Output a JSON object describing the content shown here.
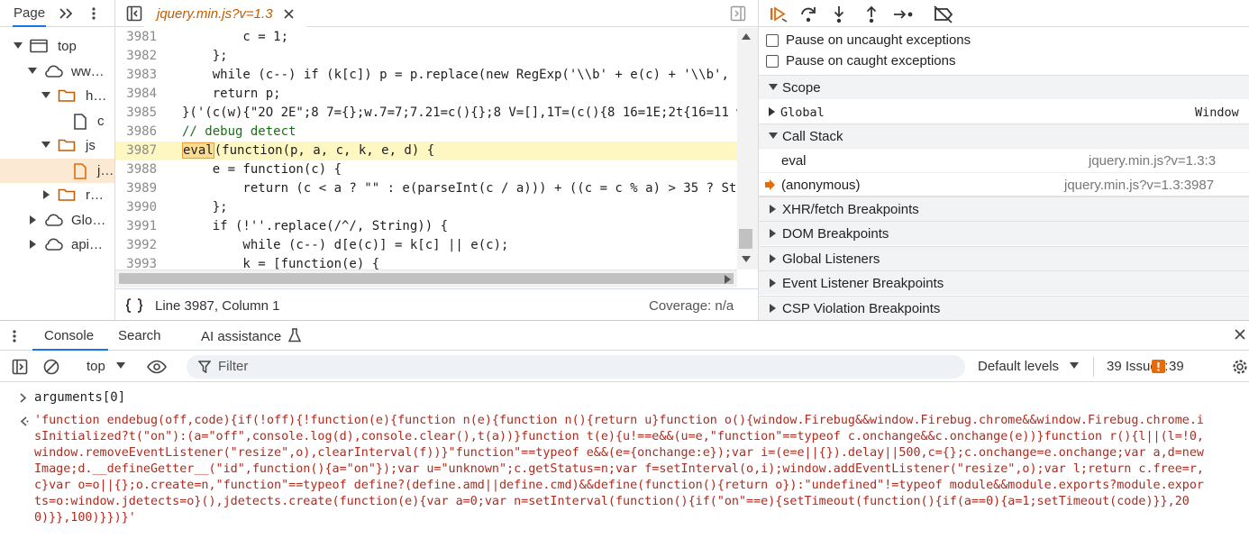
{
  "navigator": {
    "tab_label": "Page",
    "tree": [
      {
        "label": "top",
        "level": 0
      },
      {
        "label": "ww…",
        "level": 1
      },
      {
        "label": "h…",
        "level": 2
      },
      {
        "label": "c",
        "level": 3
      },
      {
        "label": "js",
        "level": 2
      },
      {
        "label": "j…",
        "level": 3
      },
      {
        "label": "r…",
        "level": 2
      },
      {
        "label": "Glo…",
        "level": 1
      },
      {
        "label": "api…",
        "level": 1
      }
    ]
  },
  "editor": {
    "tab_label": "jquery.min.js?v=1.3",
    "lines": [
      {
        "n": "3981",
        "t": "        c = 1;"
      },
      {
        "n": "3982",
        "t": "    };"
      },
      {
        "n": "3983",
        "t": "    while (c--) if (k[c]) p = p.replace(new RegExp('\\\\b' + e(c) + '\\\\b', 'g"
      },
      {
        "n": "3984",
        "t": "    return p;"
      },
      {
        "n": "3985",
        "t": "}('(c(w){\"2O 2E\";8 7={};w.7=7;7.21=c(){};8 V=[],1T=(c(){8 16=1E;2t{16=11 w."
      },
      {
        "n": "3986",
        "t": "// debug detect"
      },
      {
        "n": "3987",
        "t": "(function(p, a, c, k, e, d) {",
        "mark": "eval"
      },
      {
        "n": "3988",
        "t": "    e = function(c) {"
      },
      {
        "n": "3989",
        "t": "        return (c < a ? \"\" : e(parseInt(c / a))) + ((c = c % a) > 35 ? Stri"
      },
      {
        "n": "3990",
        "t": "    };"
      },
      {
        "n": "3991",
        "t": "    if (!''.replace(/^/, String)) {"
      },
      {
        "n": "3992",
        "t": "        while (c--) d[e(c)] = k[c] || e(c);"
      },
      {
        "n": "3993",
        "t": "        k = [function(e) {"
      }
    ],
    "status": {
      "cursor": "Line 3987, Column 1",
      "coverage": "Coverage: n/a"
    }
  },
  "debugger": {
    "pause_uncaught": "Pause on uncaught exceptions",
    "pause_caught": "Pause on caught exceptions",
    "scope_label": "Scope",
    "global_label": "Global",
    "global_value": "Window",
    "callstack_label": "Call Stack",
    "frames": [
      {
        "name": "eval",
        "location": "jquery.min.js?v=1.3:3"
      },
      {
        "name": "(anonymous)",
        "location": "jquery.min.js?v=1.3:3987"
      }
    ],
    "sections": [
      "XHR/fetch Breakpoints",
      "DOM Breakpoints",
      "Global Listeners",
      "Event Listener Breakpoints",
      "CSP Violation Breakpoints"
    ]
  },
  "drawer": {
    "tabs": {
      "console": "Console",
      "search": "Search",
      "ai": "AI assistance"
    }
  },
  "console": {
    "context": "top",
    "filter_placeholder": "Filter",
    "levels": "Default levels",
    "issues_label": "39 Issues:",
    "issues_count": "39",
    "input": "arguments[0]",
    "result": "'function endebug(off,code){if(!off){!function(e){function n(e){function n(){return u}function o(){window.Firebug&&window.Firebug.chrome&&window.Firebug.chrome.i\nsInitialized?t(\"on\"):(a=\"off\",console.log(d),console.clear(),t(a))}function t(e){u!==e&&(u=e,\"function\"==typeof c.onchange&&c.onchange(e))}function r(){l||(l=!0,\nwindow.removeEventListener(\"resize\",o),clearInterval(f))}\"function\"==typeof e&&(e={onchange:e});var i=(e=e||{}).delay||500,c={};c.onchange=e.onchange;var a,d=new\nImage;d.__defineGetter__(\"id\",function(){a=\"on\"});var u=\"unknown\";c.getStatus=n;var f=setInterval(o,i);window.addEventListener(\"resize\",o);var l;return c.free=r,\nc}var o=o||{};o.create=n,\"function\"==typeof define?(define.amd||define.cmd)&&define(function(){return o}):\"undefined\"!=typeof module&&module.exports?module.expor\nts=o:window.jdetects=o}(),jdetects.create(function(e){var a=0;var n=setInterval(function(){if(\"on\"==e){setTimeout(function(){if(a==0){a=1;setTimeout(code)}},20\n0)}},100)}})}'"
  }
}
